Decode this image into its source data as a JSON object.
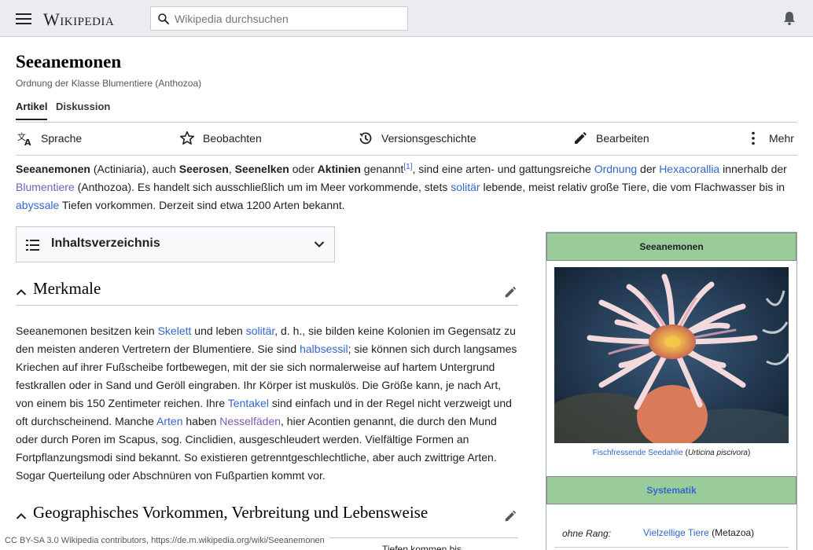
{
  "header": {
    "logo_text": "Wikipedia",
    "search_placeholder": "Wikipedia durchsuchen"
  },
  "page": {
    "title": "Seeanemonen",
    "subtitle": "Ordnung der Klasse Blumentiere (Anthozoa)"
  },
  "tabs": [
    {
      "label": "Artikel",
      "active": true
    },
    {
      "label": "Diskussion",
      "active": false
    }
  ],
  "actions": {
    "language": "Sprache",
    "watch": "Beobachten",
    "history": "Versionsgeschichte",
    "edit": "Bearbeiten",
    "more": "Mehr"
  },
  "lead": {
    "b1": "Seeanemonen",
    "t1": " (Actiniaria), auch ",
    "b2": "Seerosen",
    "t2": ", ",
    "b3": "Seenelken",
    "t3": " oder ",
    "b4": "Aktinien",
    "t4": " genannt",
    "ref": "[1]",
    "t5": ", sind eine arten- und gattungsreiche ",
    "l1": "Ordnung",
    "t6": " der ",
    "l2": "Hexacorallia",
    "t7": " innerhalb der ",
    "l3": "Blumentiere",
    "t8": " (Anthozoa). Es handelt sich ausschließlich um im Meer vorkommende, stets ",
    "l4": "solitär",
    "t9": " lebende, meist relativ große Tiere, die vom Flachwasser bis in ",
    "l5": "abyssale",
    "t10": " Tiefen vorkommen. Derzeit sind etwa 1200 Arten bekannt."
  },
  "toc": {
    "title": "Inhaltsverzeichnis"
  },
  "sections": [
    {
      "title": "Merkmale"
    },
    {
      "title": "Geographisches Vorkommen, Verbreitung und Lebensweise"
    }
  ],
  "merkmale": {
    "t1": "Seeanemonen besitzen kein ",
    "l1": "Skelett",
    "t2": " und leben ",
    "l2": "solitär",
    "t3": ", d. h., sie bilden keine Kolonien im Gegensatz zu den meisten anderen Vertretern der Blumentiere. Sie sind ",
    "l3": "halbsessil",
    "t4": "; sie können sich durch langsames Kriechen auf ihrer Fußscheibe fortbewegen, mit der sie sich normalerweise auf hartem Untergrund festkrallen oder in Sand und Geröll eingraben. Ihr Körper ist muskulös. Die Größe kann, je nach Art, von einem bis 150 Zentimeter reichen. Ihre ",
    "l4": "Tentakel",
    "t5": " sind einfach und in der Regel nicht verzweigt und oft durchscheinend. Manche ",
    "l5": "Arten",
    "t6": " haben ",
    "l6": "Nesselfäden",
    "t7": ", hier Acontien genannt, die durch den Mund oder durch Poren im Scapus, sog. Cinclidien, ausgeschleudert werden. Vielfältige Formen an Fortpflanzungsmodi sind bekannt. So existieren getrenntgeschlechtliche, aber auch zwittrige Arten. Sogar Querteilung oder Abschnüren von Fußpartien kommt vor."
  },
  "infobox": {
    "title": "Seeanemonen",
    "caption_link": "Fischfressende Seedahlie",
    "caption_open": " (",
    "caption_italic": "Urticina piscivora",
    "caption_close": ")",
    "systematik": "Systematik",
    "row_key": "ohne Rang:",
    "row_link": "Vielzellige Tiere",
    "row_rest": " (Metazoa)"
  },
  "footer": {
    "license": "CC BY-SA 3.0 Wikipedia contributors, https://de.m.wikipedia.org/wiki/Seeanemonen",
    "cut_text": "Tiefen kommen bis"
  },
  "colors": {
    "link": "#3366cc",
    "visited": "#795cb2",
    "infobox_green": "#99cc99"
  }
}
